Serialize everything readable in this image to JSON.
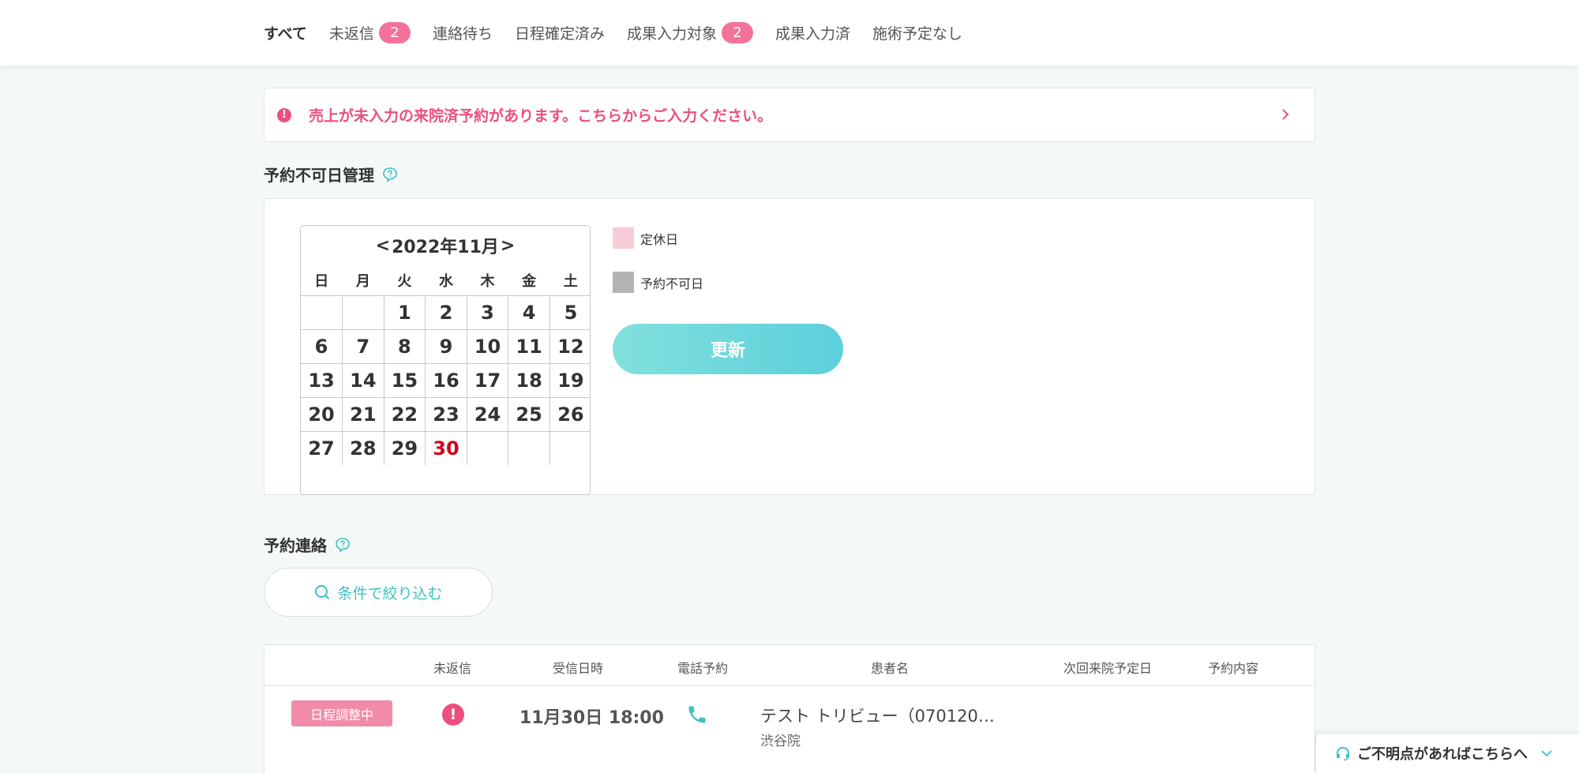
{
  "tabs": [
    {
      "label": "すべて",
      "active": true,
      "badge": ""
    },
    {
      "label": "未返信",
      "badge": "2"
    },
    {
      "label": "連絡待ち",
      "badge": ""
    },
    {
      "label": "日程確定済み",
      "badge": ""
    },
    {
      "label": "成果入力対象",
      "badge": "2"
    },
    {
      "label": "成果入力済",
      "badge": ""
    },
    {
      "label": "施術予定なし",
      "badge": ""
    }
  ],
  "alert": {
    "icon_text": "!",
    "text": "売上が未入力の来院済予約があります。こちらからご入力ください。"
  },
  "unavailable_section": {
    "title": "予約不可日管理"
  },
  "calendar": {
    "prev": "<",
    "next": ">",
    "month_label": "2022年11月",
    "weekdays": [
      "日",
      "月",
      "火",
      "水",
      "木",
      "金",
      "土"
    ],
    "weeks": [
      [
        "",
        "",
        "1",
        "2",
        "3",
        "4",
        "5"
      ],
      [
        "6",
        "7",
        "8",
        "9",
        "10",
        "11",
        "12"
      ],
      [
        "13",
        "14",
        "15",
        "16",
        "17",
        "18",
        "19"
      ],
      [
        "20",
        "21",
        "22",
        "23",
        "24",
        "25",
        "26"
      ],
      [
        "27",
        "28",
        "29",
        "30",
        "",
        "",
        ""
      ]
    ],
    "today": "30"
  },
  "legend": {
    "holiday_label": "定休日",
    "holiday_color": "#f8cdd8",
    "unavailable_label": "予約不可日",
    "unavailable_color": "#b3b3b3"
  },
  "update_button": "更新",
  "contact_section": {
    "title": "予約連絡",
    "filter_button": "条件で絞り込む"
  },
  "table": {
    "headers": [
      "未返信",
      "受信日時",
      "電話予約",
      "患者名",
      "次回来院予定日",
      "予約内容"
    ],
    "rows": [
      {
        "status": "日程調整中",
        "unreplied": "!",
        "received": "11月30日 18:00",
        "patient": "テスト トリビュー（070120…",
        "clinic": "渋谷院"
      }
    ]
  },
  "help_widget": {
    "text": "ご不明点があればこちらへ"
  },
  "colors": {
    "accent": "#3ec1c2",
    "alert": "#ec4f7e",
    "badge": "#f2729a"
  }
}
